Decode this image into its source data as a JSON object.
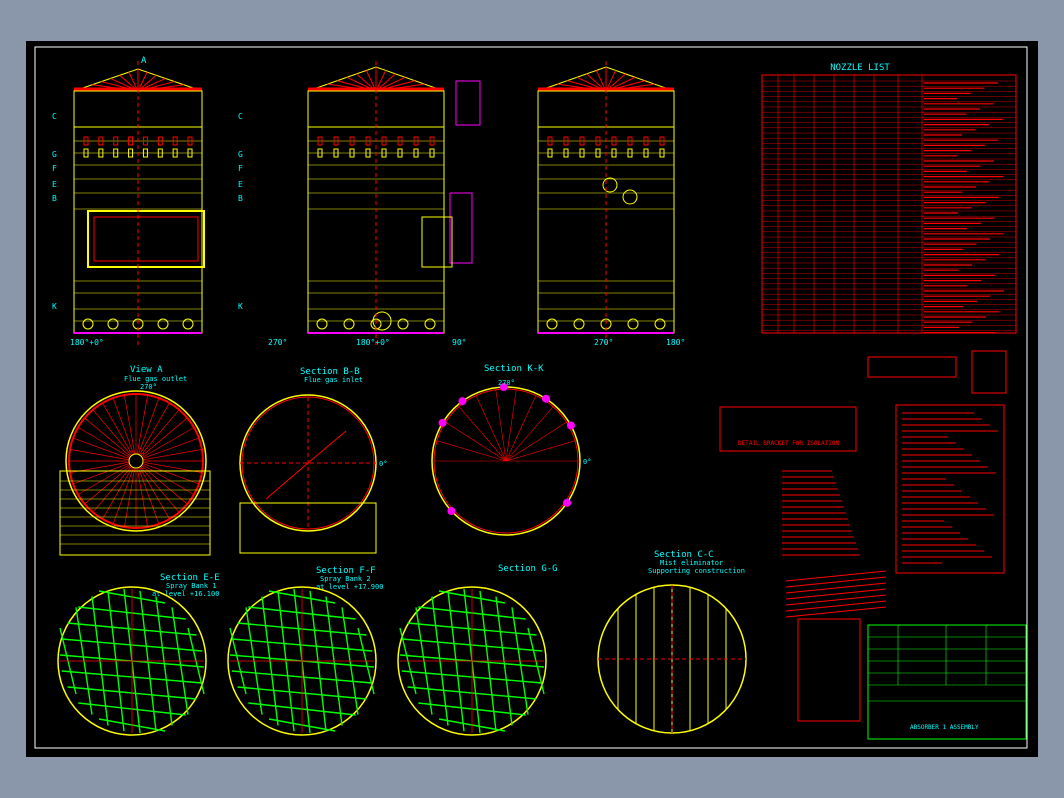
{
  "labels": {
    "nozzle_list_title": "NOZZLE LIST",
    "view_a_title": "View A",
    "view_a_sub": "Flue gas outlet",
    "section_bb_title": "Section B-B",
    "section_bb_sub": "Flue gas inlet",
    "section_kk_title": "Section K-K",
    "section_ee_title": "Section E-E",
    "section_ee_sub1": "Spray Bank 1",
    "section_ee_sub2": "at level +16.100",
    "section_ff_title": "Section F-F",
    "section_ff_sub1": "Spray Bank 2",
    "section_ff_sub2": "at level +17.900",
    "section_gg_title": "Section G-G",
    "section_cc_title": "Section C-C",
    "section_cc_sub1": "Mist eliminator",
    "section_cc_sub2": "Supporting construction",
    "detail_title": "DETAIL BRACKET FOR ISOLATION",
    "title_block_name": "ABSORBER 1 ASSEMBLY",
    "elev1_bottom": "180°+0°",
    "elev2_bottom": "180°+0°",
    "deg_270": "270°",
    "deg_90": "90°",
    "deg_0": "0°",
    "deg_180": "180°",
    "letter_a": "A",
    "letter_c": "C",
    "letter_g": "G",
    "letter_f": "F",
    "letter_e": "E",
    "letter_b": "B",
    "letter_k": "K"
  },
  "colors": {
    "background": "#000000",
    "frame": "#ffffff",
    "vessel": "#ffff00",
    "roof": "#ff0000",
    "spray": "#00ff00",
    "annotation_text": "#00ffff",
    "piping": "#ff00ff",
    "table_lines": "#ff0000",
    "title_block": "#00ff00"
  }
}
